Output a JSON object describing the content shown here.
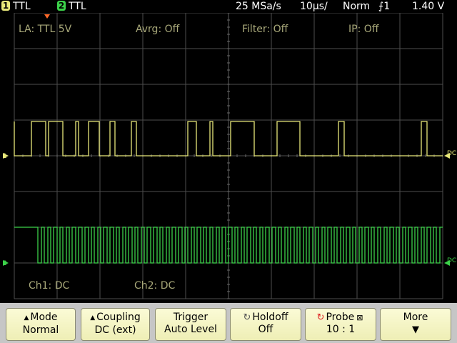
{
  "status": {
    "ch1_badge": "1",
    "ch1_label": "TTL",
    "ch2_badge": "2",
    "ch2_label": "TTL",
    "sample_rate": "25 MSa/s",
    "timebase": "10µs/",
    "trigger_mode": "Norm",
    "trigger_icon": "rising-edge-icon",
    "trigger_source": "1",
    "trigger_level": "1.40 V"
  },
  "overlay": {
    "la": "LA: TTL 5V",
    "avrg": "Avrg: Off",
    "filter": "Filter: Off",
    "ip": "IP: Off",
    "ch1_coupling": "Ch1: DC",
    "ch2_coupling": "Ch2: DC",
    "ch1_marker": "1",
    "ch2_marker": "2",
    "ch1_right": "DC",
    "ch2_right": "DC"
  },
  "colors": {
    "ch1": "#e8e87a",
    "ch2": "#3cd24a",
    "grid": "#4e4e4e",
    "overlay_text": "#a9a97a",
    "status_text": "#ffffff"
  },
  "chart_data": {
    "type": "line",
    "x_divisions": 10,
    "y_divisions": 8,
    "grid": true,
    "series": [
      {
        "color": "#e8e87a",
        "transitions": [
          20,
          44,
          64,
          68,
          88,
          106,
          110,
          124,
          139,
          154,
          161,
          184,
          191,
          263,
          275,
          294,
          298,
          323,
          356,
          388,
          420,
          474,
          482,
          590,
          598
        ],
        "start_level": "high"
      },
      {
        "color": "#3cd24a",
        "transitions": [
          53,
          58,
          62,
          67,
          71,
          75,
          80,
          84,
          88,
          93,
          97,
          101,
          106,
          110,
          115,
          119,
          124,
          128,
          132,
          137,
          141,
          145,
          150,
          154,
          159,
          163,
          167,
          172,
          176,
          180,
          185,
          189,
          193,
          198,
          202,
          206,
          211,
          215,
          220,
          224,
          228,
          233,
          237,
          241,
          246,
          250,
          255,
          259,
          263,
          268,
          272,
          276,
          281,
          285,
          289,
          294,
          298,
          303,
          307,
          311,
          316,
          320,
          325,
          329,
          333,
          338,
          342,
          346,
          351,
          355,
          359,
          364,
          368,
          372,
          377,
          381,
          386,
          390,
          394,
          399,
          403,
          407,
          412,
          416,
          420,
          425,
          429,
          433,
          438,
          442,
          446,
          451,
          455,
          459,
          464,
          468,
          472,
          477,
          481,
          485,
          490,
          494,
          498,
          503,
          507,
          511,
          516,
          520,
          524,
          529,
          533,
          538,
          542,
          546,
          551,
          555,
          559,
          564,
          568,
          572,
          577,
          581,
          585,
          590,
          594,
          598,
          603,
          607,
          611,
          616
        ],
        "start_level": "high"
      }
    ]
  },
  "softkeys": {
    "mode": {
      "line1": "Mode",
      "line2": "Normal",
      "icon": "up-triangle-icon"
    },
    "coupling": {
      "line1": "Coupling",
      "line2": "DC (ext)",
      "icon": "up-triangle-icon"
    },
    "trigger": {
      "line1": "Trigger",
      "line2": "Auto Level"
    },
    "holdoff": {
      "line1": "Holdoff",
      "line2": "Off",
      "icon": "rotate-knob-icon"
    },
    "probe": {
      "line1": "Probe",
      "line2": "10 : 1",
      "icon": "rotate-knob-icon",
      "icon2": "close-box-icon"
    },
    "more": {
      "line1": "More",
      "icon": "down-arrow-icon"
    }
  }
}
